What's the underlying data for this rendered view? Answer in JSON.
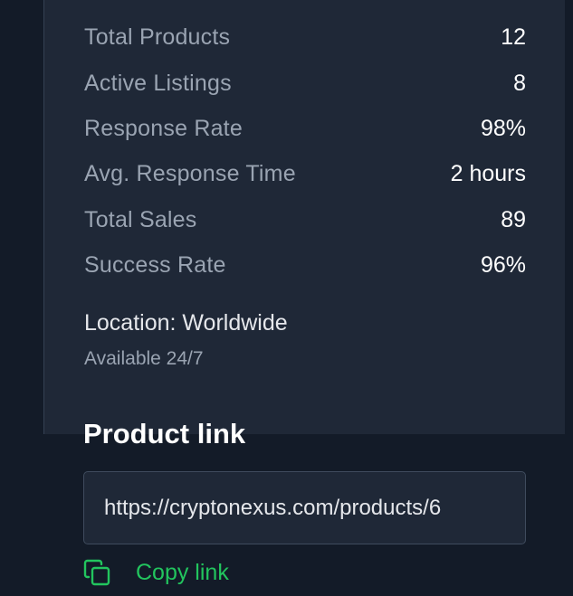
{
  "stats": [
    {
      "label": "Total Products",
      "value": "12"
    },
    {
      "label": "Active Listings",
      "value": "8"
    },
    {
      "label": "Response Rate",
      "value": "98%"
    },
    {
      "label": "Avg. Response Time",
      "value": "2 hours"
    },
    {
      "label": "Total Sales",
      "value": "89"
    },
    {
      "label": "Success Rate",
      "value": "96%"
    }
  ],
  "location": "Location: Worldwide",
  "availability": "Available 24/7",
  "product_link": {
    "title": "Product link",
    "url": "https://cryptonexus.com/products/6",
    "copy_label": "Copy link",
    "copy_icon": "copy-icon"
  },
  "colors": {
    "accent": "#22c55e",
    "card_background": "#1f2837",
    "page_background": "#131b28"
  }
}
